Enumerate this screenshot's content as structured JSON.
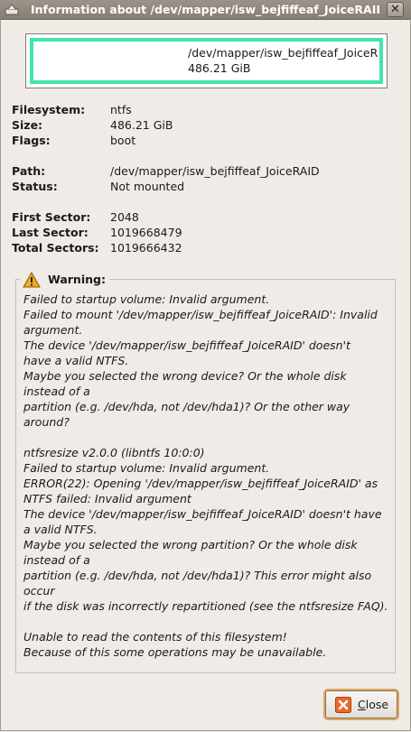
{
  "window": {
    "title": "Information about /dev/mapper/isw_bejfiffeaf_JoiceRAID",
    "close_symbol": "✕"
  },
  "partition_graphic": {
    "path": "/dev/mapper/isw_bejfiffeaf_JoiceRAID",
    "size": "486.21 GiB",
    "fill_color": "#42e5ac"
  },
  "info": {
    "filesystem": {
      "label": "Filesystem:",
      "value": "ntfs"
    },
    "size": {
      "label": "Size:",
      "value": "486.21 GiB"
    },
    "flags": {
      "label": "Flags:",
      "value": "boot"
    },
    "path": {
      "label": "Path:",
      "value": "/dev/mapper/isw_bejfiffeaf_JoiceRAID"
    },
    "status": {
      "label": "Status:",
      "value": "Not mounted"
    },
    "first_sector": {
      "label": "First Sector:",
      "value": "2048"
    },
    "last_sector": {
      "label": "Last Sector:",
      "value": "1019668479"
    },
    "total_sectors": {
      "label": "Total Sectors:",
      "value": "1019666432"
    }
  },
  "warning": {
    "label": "Warning:",
    "message": "Failed to startup volume: Invalid argument.\nFailed to mount '/dev/mapper/isw_bejfiffeaf_JoiceRAID': Invalid\nargument.\nThe device '/dev/mapper/isw_bejfiffeaf_JoiceRAID' doesn't\nhave a valid NTFS.\nMaybe you selected the wrong device? Or the whole disk\ninstead of a\npartition (e.g. /dev/hda, not /dev/hda1)? Or the other way\naround?\n\nntfsresize v2.0.0 (libntfs 10:0:0)\nFailed to startup volume: Invalid argument.\nERROR(22): Opening '/dev/mapper/isw_bejfiffeaf_JoiceRAID' as\nNTFS failed: Invalid argument\nThe device '/dev/mapper/isw_bejfiffeaf_JoiceRAID' doesn't have\na valid NTFS.\nMaybe you selected the wrong partition? Or the whole disk\ninstead of a\npartition (e.g. /dev/hda, not /dev/hda1)? This error might also\noccur\nif the disk was incorrectly repartitioned (see the ntfsresize FAQ).\n\nUnable to read the contents of this filesystem!\nBecause of this some operations may be unavailable."
  },
  "buttons": {
    "close_mnemonic": "C",
    "close_rest": "lose"
  }
}
